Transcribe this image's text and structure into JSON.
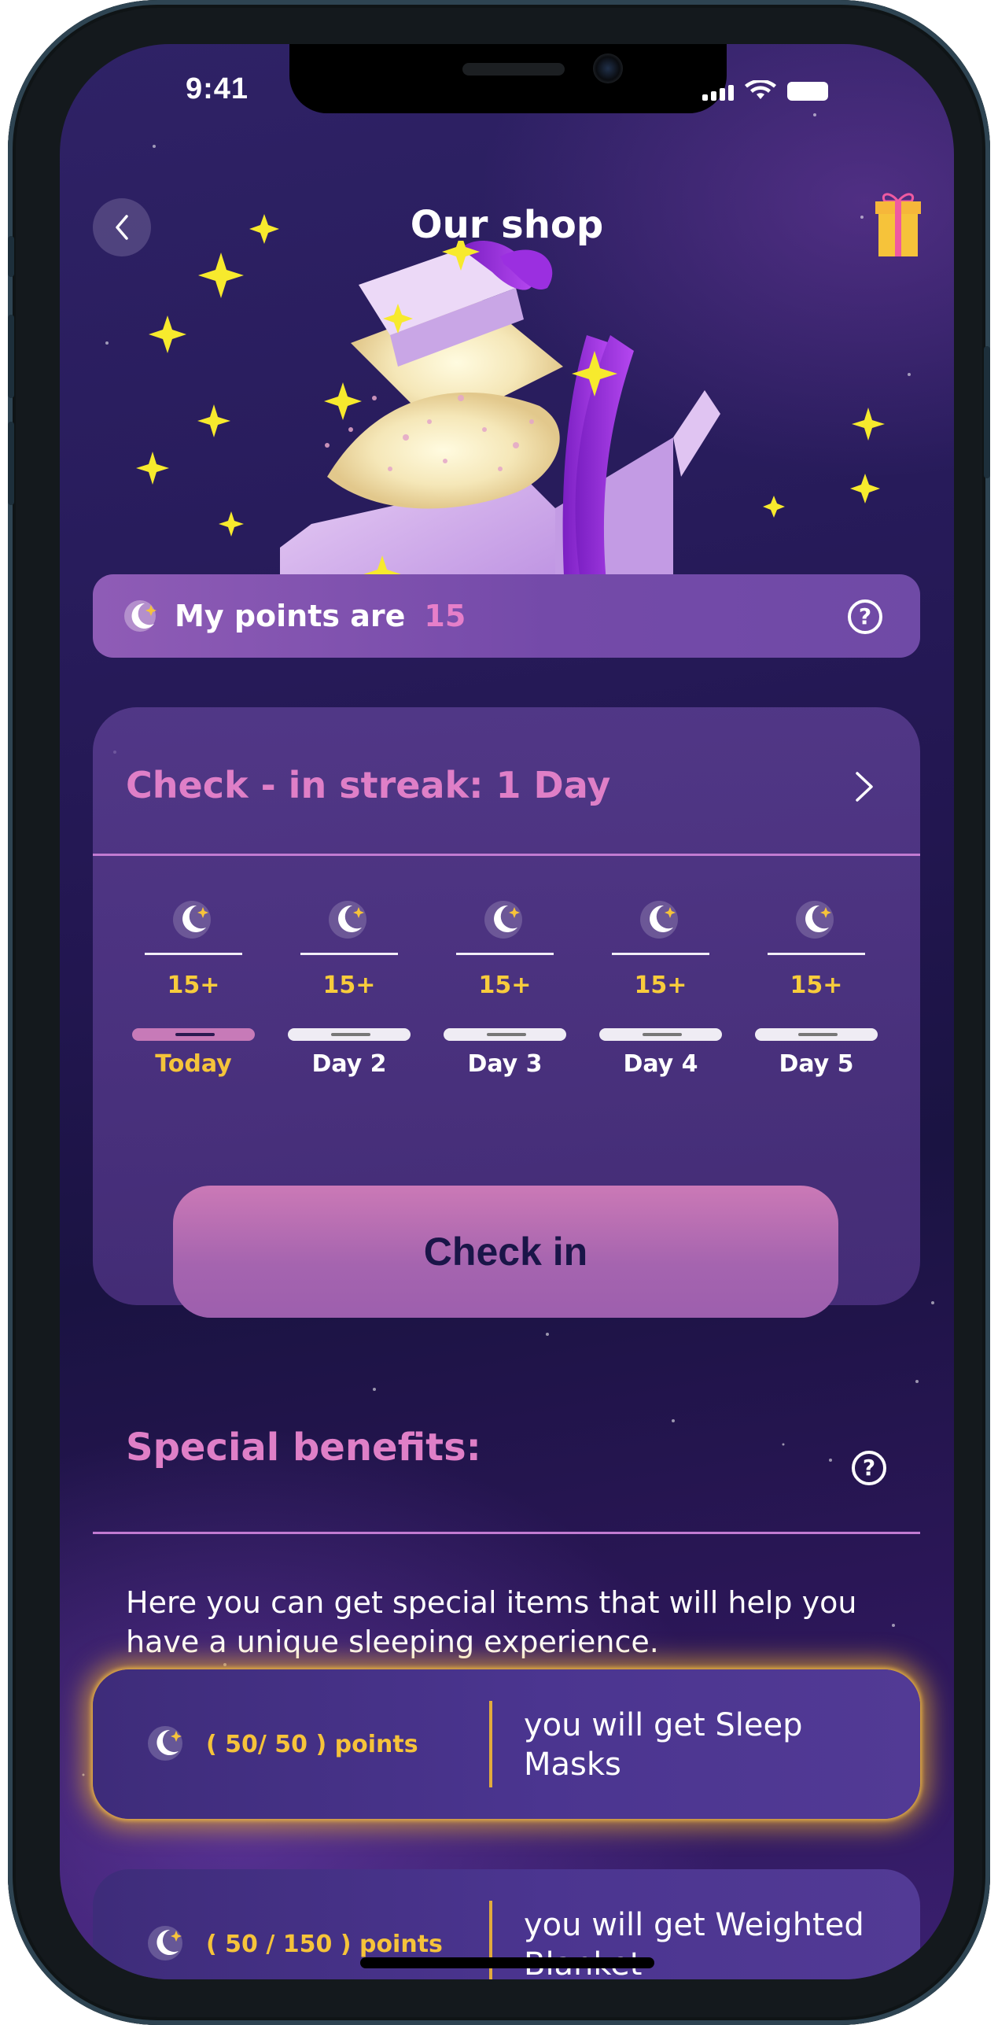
{
  "status_bar": {
    "time": "9:41"
  },
  "header": {
    "title": "Our shop"
  },
  "points": {
    "label": "My points are",
    "value": "15"
  },
  "streak": {
    "title": "Check - in streak: 1 Day",
    "days": [
      {
        "bonus": "15+",
        "label": "Today",
        "active": true
      },
      {
        "bonus": "15+",
        "label": "Day 2",
        "active": false
      },
      {
        "bonus": "15+",
        "label": "Day 3",
        "active": false
      },
      {
        "bonus": "15+",
        "label": "Day 4",
        "active": false
      },
      {
        "bonus": "15+",
        "label": "Day 5",
        "active": false
      }
    ],
    "checkin_label": "Check in"
  },
  "benefits": {
    "title": "Special benefits:",
    "description": "Here you can get special items that will help you have a unique sleeping experience.",
    "items": [
      {
        "cost": "( 50/ 50 ) points",
        "reward": "you will get Sleep Masks",
        "highlighted": true
      },
      {
        "cost": "( 50 / 150 ) points",
        "reward": "you will get Weighted Blanket",
        "highlighted": false
      }
    ]
  },
  "colors": {
    "accent_pink": "#df7fc7",
    "accent_gold": "#f6c33a",
    "background": "#231852"
  }
}
